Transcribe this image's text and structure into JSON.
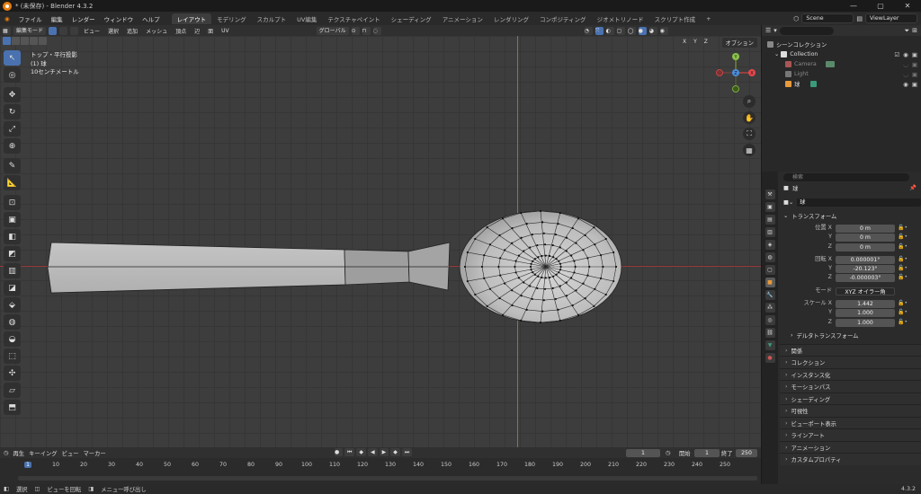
{
  "window": {
    "title": "* (未保存) - Blender 4.3.2",
    "min": "—",
    "max": "▢",
    "close": "✕"
  },
  "menu": [
    "ファイル",
    "編集",
    "レンダー",
    "ウィンドウ",
    "ヘルプ"
  ],
  "workspaces": [
    "レイアウト",
    "モデリング",
    "スカルプト",
    "UV編集",
    "テクスチャペイント",
    "シェーディング",
    "アニメーション",
    "レンダリング",
    "コンポジティング",
    "ジオメトリノード",
    "スクリプト作成"
  ],
  "workspace_add": "+",
  "scene": "Scene",
  "view_layer": "ViewLayer",
  "header3d": {
    "mode": "編集モード",
    "items": [
      "ビュー",
      "選択",
      "追加",
      "メッシュ",
      "頂点",
      "辺",
      "面",
      "UV"
    ],
    "transform": "グローバル",
    "xyz": [
      "X",
      "Y",
      "Z"
    ],
    "options": "オプション"
  },
  "viewport": {
    "line1": "トップ・平行投影",
    "line2": "(1) 球",
    "line3": "10センチメートル"
  },
  "gizmo": {
    "x": "X",
    "y": "Y",
    "z": "Z"
  },
  "tools": [
    {
      "name": "select-tool",
      "g": "↖"
    },
    {
      "name": "cursor-tool",
      "g": "◎"
    },
    {
      "name": "move-tool",
      "g": "✥"
    },
    {
      "name": "rotate-tool",
      "g": "↻"
    },
    {
      "name": "scale-tool",
      "g": "⤢"
    },
    {
      "name": "transform-tool",
      "g": "⊕"
    },
    {
      "name": "annotate-tool",
      "g": "✎"
    },
    {
      "name": "measure-tool",
      "g": "📐"
    },
    {
      "name": "add-cube-tool",
      "g": "⊡"
    },
    {
      "name": "extrude-tool",
      "g": "▣"
    },
    {
      "name": "inset-tool",
      "g": "◧"
    },
    {
      "name": "bevel-tool",
      "g": "◩"
    },
    {
      "name": "loopcut-tool",
      "g": "▥"
    },
    {
      "name": "knife-tool",
      "g": "◪"
    },
    {
      "name": "polybuild-tool",
      "g": "⬙"
    },
    {
      "name": "spin-tool",
      "g": "◍"
    },
    {
      "name": "smooth-tool",
      "g": "◒"
    },
    {
      "name": "edge-slide-tool",
      "g": "⬚"
    },
    {
      "name": "shrink-tool",
      "g": "✣"
    },
    {
      "name": "shear-tool",
      "g": "▱"
    },
    {
      "name": "rip-tool",
      "g": "⬒"
    }
  ],
  "timeline": {
    "playback": "再生",
    "keying": "キーイング",
    "view": "ビュー",
    "marker": "マーカー",
    "current": "1",
    "start_label": "開始",
    "start": "1",
    "end_label": "終了",
    "end": "250",
    "ruler": [
      "1",
      "10",
      "20",
      "30",
      "40",
      "50",
      "60",
      "70",
      "80",
      "90",
      "100",
      "110",
      "120",
      "130",
      "140",
      "150",
      "160",
      "170",
      "180",
      "190",
      "200",
      "210",
      "220",
      "230",
      "240",
      "250"
    ]
  },
  "status": {
    "select": "選択",
    "rotate": "ビューを回転",
    "menu": "メニュー呼び出し",
    "version": "4.3.2"
  },
  "outliner": {
    "search": "",
    "collection_root": "シーンコレクション",
    "items": [
      "Collection",
      "Camera",
      "Light",
      "球"
    ]
  },
  "properties": {
    "search": "検索",
    "object": "球",
    "mesh": "球",
    "transform_title": "トランスフォーム",
    "loc_label": "位置 X",
    "loc": [
      "0 m",
      "0 m",
      "0 m"
    ],
    "rot_label": "回転 X",
    "rot": [
      "0.000001°",
      "-20.123°",
      "-0.000003°"
    ],
    "mode_label": "モード",
    "mode": "XYZ オイラー角",
    "scale_label": "スケール X",
    "scale": [
      "1.442",
      "1.000",
      "1.000"
    ],
    "y": "Y",
    "z": "Z",
    "delta": "デルタトランスフォーム",
    "sections": [
      "関係",
      "コレクション",
      "インスタンス化",
      "モーションパス",
      "シェーディング",
      "可視性",
      "ビューポート表示",
      "ラインアート",
      "アニメーション",
      "カスタムプロパティ"
    ]
  }
}
